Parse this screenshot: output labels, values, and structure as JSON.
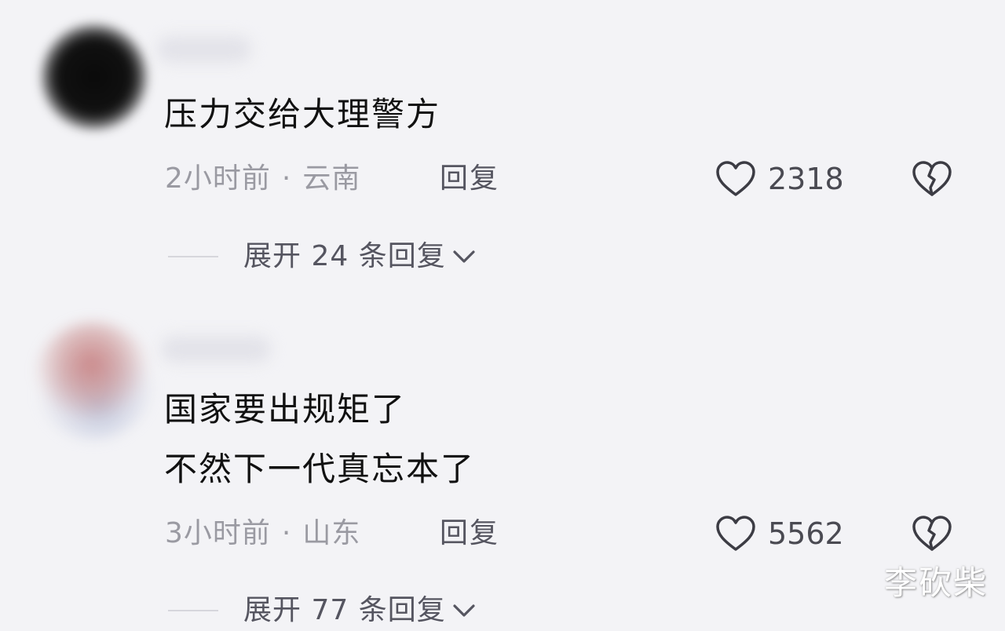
{
  "comments": [
    {
      "lines": [
        "压力交给大理警方"
      ],
      "time": "2小时前",
      "separator": "·",
      "location": "云南",
      "reply_label": "回复",
      "likes": "2318",
      "expand_label": "展开 24 条回复"
    },
    {
      "lines": [
        "国家要出规矩了",
        "不然下一代真忘本了"
      ],
      "time": "3小时前",
      "separator": "·",
      "location": "山东",
      "reply_label": "回复",
      "likes": "5562",
      "expand_label": "展开 77 条回复"
    }
  ],
  "watermark": "李砍柴",
  "icons": {
    "like": "heart-outline-icon",
    "dislike": "broken-heart-icon",
    "expand": "chevron-down-icon"
  },
  "colors": {
    "background": "#f3f3f6",
    "text_primary": "#111111",
    "text_meta": "#9a9aa2",
    "text_action": "#555560"
  }
}
